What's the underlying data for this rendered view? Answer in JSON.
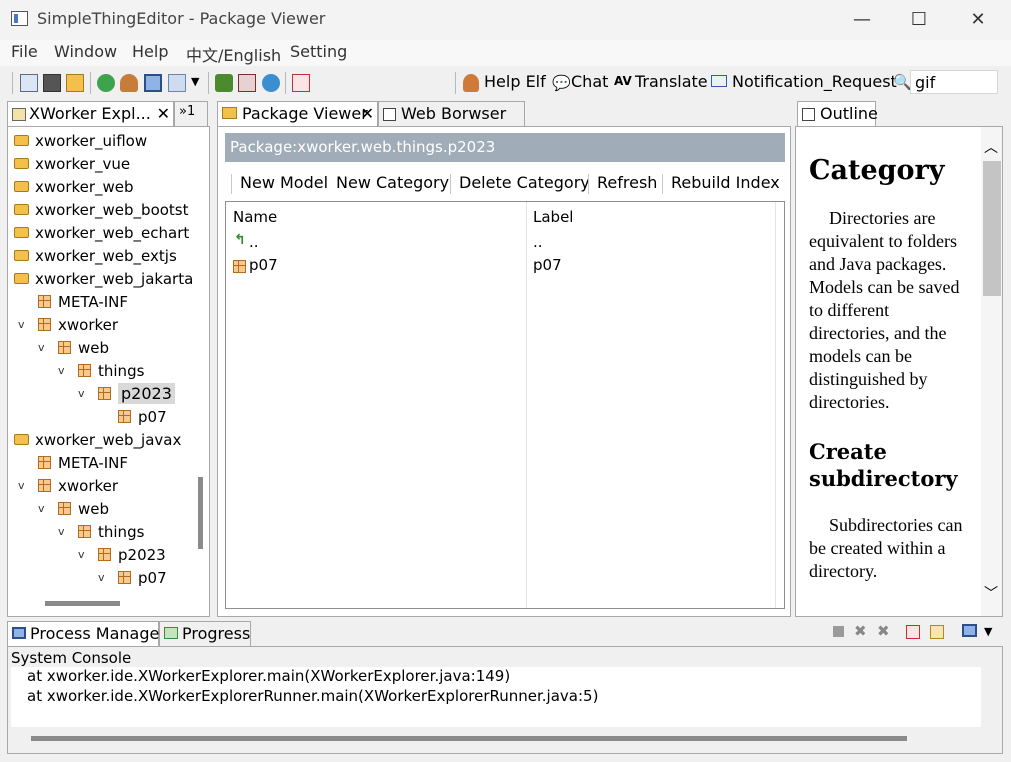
{
  "window": {
    "title": "SimpleThingEditor - Package Viewer",
    "minimize": "—",
    "maximize": "☐",
    "close": "✕"
  },
  "menu": [
    "File",
    "Window",
    "Help",
    "中文/English",
    "Setting"
  ],
  "toolbar": {
    "help_elf": "Help Elf",
    "chat": "Chat",
    "translate": "Translate",
    "notification": "Notification_Request",
    "search_value": "gif"
  },
  "explorer": {
    "tab_label": "XWorker Expl...",
    "more_tabs": "»1",
    "items": [
      {
        "label": "xworker_uiflow",
        "kind": "folder",
        "indent": 0,
        "expand": ""
      },
      {
        "label": "xworker_vue",
        "kind": "folder",
        "indent": 0,
        "expand": ""
      },
      {
        "label": "xworker_web",
        "kind": "folder",
        "indent": 0,
        "expand": ""
      },
      {
        "label": "xworker_web_bootst",
        "kind": "folder",
        "indent": 0,
        "expand": ""
      },
      {
        "label": "xworker_web_echart",
        "kind": "folder",
        "indent": 0,
        "expand": ""
      },
      {
        "label": "xworker_web_extjs",
        "kind": "folder",
        "indent": 0,
        "expand": ""
      },
      {
        "label": "xworker_web_jakarta",
        "kind": "folder",
        "indent": 0,
        "expand": ""
      },
      {
        "label": "META-INF",
        "kind": "pkg",
        "indent": 1,
        "expand": ""
      },
      {
        "label": "xworker",
        "kind": "pkg",
        "indent": 1,
        "expand": "v"
      },
      {
        "label": "web",
        "kind": "pkg",
        "indent": 2,
        "expand": "v"
      },
      {
        "label": "things",
        "kind": "pkg",
        "indent": 3,
        "expand": "v"
      },
      {
        "label": "p2023",
        "kind": "pkg",
        "indent": 4,
        "expand": "v",
        "selected": true
      },
      {
        "label": "p07",
        "kind": "pkg",
        "indent": 5,
        "expand": ""
      },
      {
        "label": "xworker_web_javax",
        "kind": "folder",
        "indent": 0,
        "expand": ""
      },
      {
        "label": "META-INF",
        "kind": "pkg",
        "indent": 1,
        "expand": ""
      },
      {
        "label": "xworker",
        "kind": "pkg",
        "indent": 1,
        "expand": "v"
      },
      {
        "label": "web",
        "kind": "pkg",
        "indent": 2,
        "expand": "v"
      },
      {
        "label": "things",
        "kind": "pkg",
        "indent": 3,
        "expand": "v"
      },
      {
        "label": "p2023",
        "kind": "pkg",
        "indent": 4,
        "expand": "v"
      },
      {
        "label": "p07",
        "kind": "pkg",
        "indent": 5,
        "expand": "v"
      }
    ]
  },
  "viewer": {
    "tab_label": "Package Viewer",
    "tab2_label": "Web Borwser",
    "package_path": "Package:xworker.web.things.p2023",
    "actions": [
      "New Model",
      "New Category",
      "Delete Category",
      "Refresh",
      "Rebuild Index"
    ],
    "columns": [
      "Name",
      "Label"
    ],
    "rows": [
      {
        "name": "..",
        "label": "..",
        "icon": "up-arrow-icon"
      },
      {
        "name": "p07",
        "label": "p07",
        "icon": "package-icon"
      }
    ]
  },
  "outline": {
    "tab_label": "Outline",
    "heading1": "Category",
    "para1": "Directories are equivalent to folders and Java packages. Models can be saved to different directories, and the models can be distinguished by directories.",
    "heading2": "Create subdirectory",
    "para2": "Subdirectories can be created within a directory."
  },
  "bottom": {
    "tab1": "Process Manager",
    "tab2": "Progress",
    "console_title": "System Console",
    "lines": [
      "at xworker.ide.XWorkerExplorer.main(XWorkerExplorer.java:149)",
      "at xworker.ide.XWorkerExplorerRunner.main(XWorkerExplorerRunner.java:5)"
    ]
  }
}
